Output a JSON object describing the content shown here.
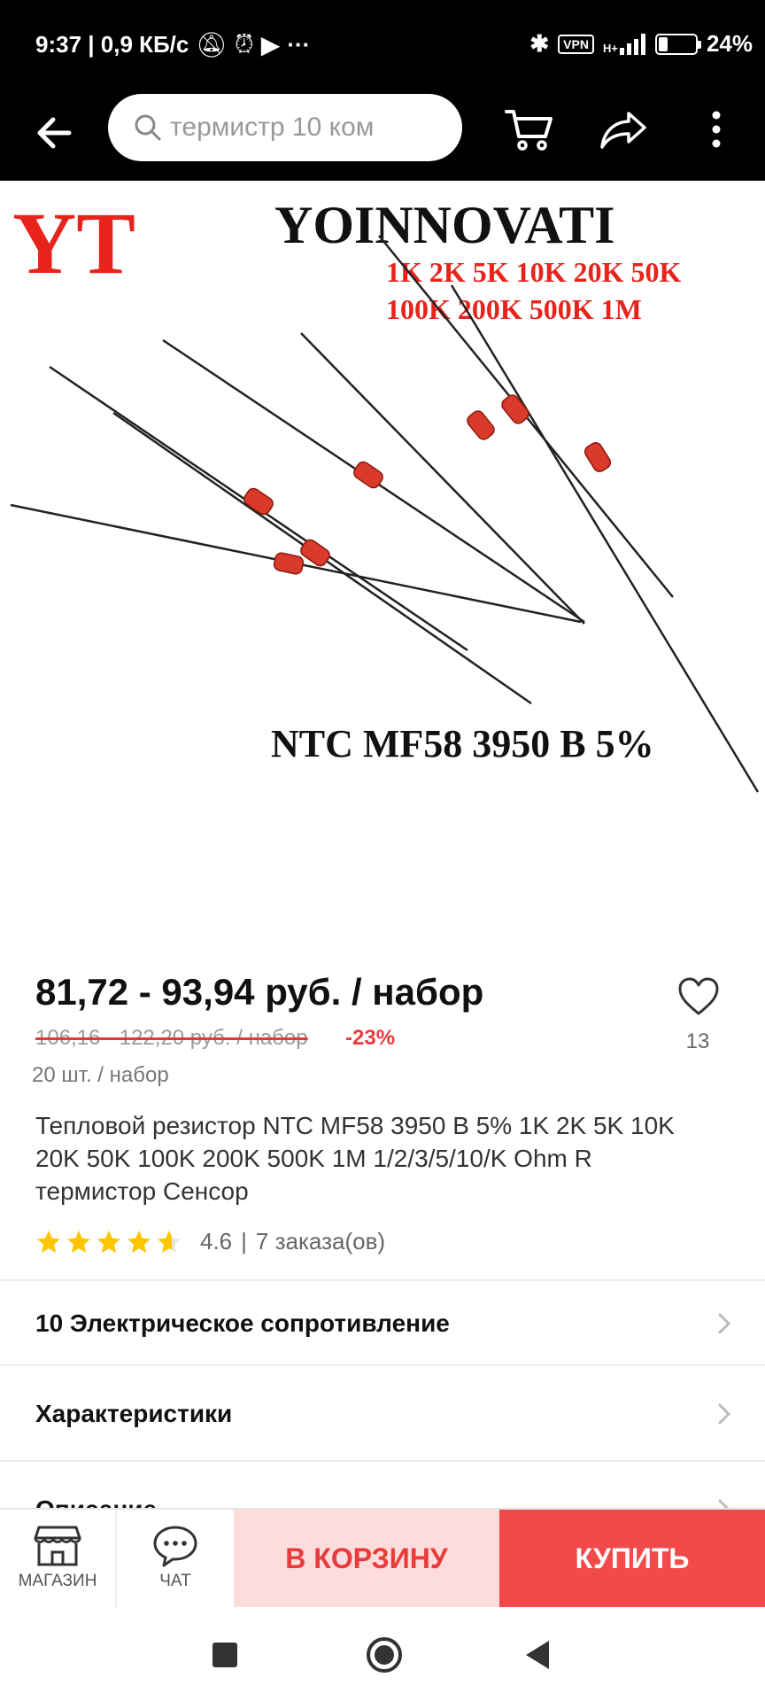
{
  "status_bar": {
    "time_speed": "9:37 | 0,9 КБ/с",
    "more": "···",
    "vpn": "VPN",
    "network": "H+",
    "battery": "24%",
    "battery_level": 0.24
  },
  "top_bar": {
    "search_placeholder": "термистр 10 ком"
  },
  "product_image": {
    "brand_logo": "YT",
    "brand_name": "YOINNOVATI",
    "values_line1": "1K 2K 5K 10K 20K 50K",
    "values_line2": "100K 200K 500K 1M",
    "caption": "NTC MF58 3950 B 5%"
  },
  "product": {
    "price": "81,72 - 93,94 руб. / набор",
    "old_price": "106,16 - 122,20 руб. / набор",
    "discount": "-23%",
    "set_quantity": "20 шт. / набор",
    "wishlist_count": "13",
    "title": "Тепловой резистор NTC MF58 3950 B 5% 1K 2K 5K 10K 20K 50K 100K 200K 500K 1M 1/2/3/5/10/K Ohm R термистор Сенсор",
    "rating": "4.6",
    "orders": "7 заказа(ов)",
    "rating_value": 4.6
  },
  "sections": [
    {
      "label": "10 Электрическое сопротивление"
    },
    {
      "label": "Характеристики"
    },
    {
      "label": "Описание"
    }
  ],
  "action_bar": {
    "shop_label": "МАГАЗИН",
    "chat_label": "ЧАТ",
    "add_to_cart": "В КОРЗИНУ",
    "buy_now": "КУПИТЬ"
  },
  "colors": {
    "accent": "#f24a4a",
    "accent_light": "#fddcdc",
    "star": "#ffc600",
    "logo_red": "#e8231b"
  }
}
